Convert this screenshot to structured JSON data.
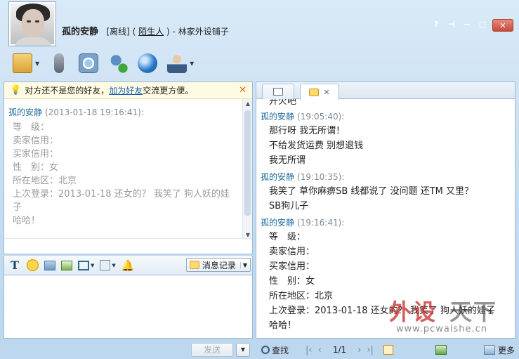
{
  "header": {
    "contact_name": "孤的安静",
    "status": "[离线]",
    "relation_open": "(",
    "relation": "陌生人",
    "relation_close": ")",
    "dash": "-",
    "shop": "林家外设铺子"
  },
  "window_controls": [
    "?",
    "⊣",
    "—",
    "▢",
    "✕"
  ],
  "toolbar": {
    "items": [
      {
        "icon": "folder-send-icon",
        "dropdown": true
      },
      {
        "icon": "microphone-icon",
        "dropdown": false
      },
      {
        "icon": "camera-icon",
        "dropdown": false
      },
      {
        "icon": "add-contact-icon",
        "dropdown": false
      },
      {
        "icon": "globe-icon",
        "dropdown": false
      },
      {
        "icon": "agent-icon",
        "dropdown": true
      }
    ]
  },
  "notice": {
    "prefix": "对方还不是您的好友，",
    "link": "加为好友",
    "suffix": "交流更方便。"
  },
  "left_chat": {
    "sender": "孤的安静",
    "time": "(2013-01-18 19:16:41):",
    "lines": [
      "等　级：",
      "卖家信用：",
      "买家信用：",
      "性　别：女",
      "所在地区：北京",
      "上次登录：2013-01-18 还女的？ 我笑了 狗人妖的娃",
      "子",
      "哈哈！"
    ]
  },
  "input_toolbar": {
    "history_label": "消息记录"
  },
  "send": {
    "label": "发送"
  },
  "right_chat": {
    "cut_line": "开火吧",
    "messages": [
      {
        "sender": "孤的安静",
        "time": "(19:05:40):",
        "lines": [
          "那行呀 我无所谓！",
          "不给发货运费 别想退钱",
          "我无所谓"
        ]
      },
      {
        "sender": "孤的安静",
        "time": "(19:10:35):",
        "lines": [
          "我笑了 草你麻痹SB 线都说了 没问题 还TM 又里？",
          "SB狗儿子"
        ]
      },
      {
        "sender": "孤的安静",
        "time": "(19:16:41):",
        "lines": [
          "等　级：",
          "卖家信用：",
          "买家信用：",
          "性　别：女",
          "所在地区：北京",
          "上次登录：2013-01-18 还女的？ 我笑了 狗人妖的娃子",
          "哈哈！"
        ]
      }
    ]
  },
  "bottom": {
    "find": "查找",
    "first": "|‹",
    "prev": "‹",
    "page": "1/1",
    "next": "›",
    "last": "›|",
    "more": "更多"
  },
  "watermark": {
    "text_red": "外设",
    "text_gray": "天下",
    "url": "www.pcwaishe.cn"
  }
}
